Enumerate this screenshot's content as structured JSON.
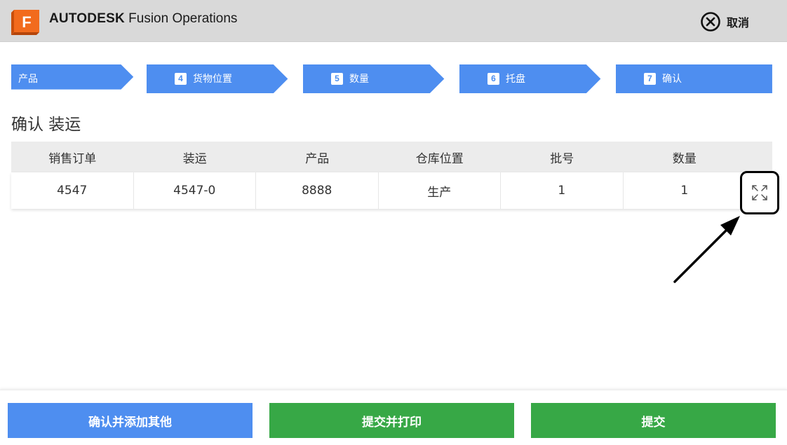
{
  "header": {
    "brand_bold": "AUTODESK",
    "brand_rest": "Fusion Operations",
    "logo_letter": "F",
    "cancel_label": "取消",
    "colors": {
      "logo": "#f26b1d",
      "bar": "#d9d9d9"
    }
  },
  "steps": [
    {
      "num": "",
      "label": "产品"
    },
    {
      "num": "4",
      "label": "货物位置"
    },
    {
      "num": "5",
      "label": "数量"
    },
    {
      "num": "6",
      "label": "托盘"
    },
    {
      "num": "7",
      "label": "确认"
    }
  ],
  "step_color": "#4e8ef0",
  "title": "确认 装运",
  "table": {
    "columns": [
      "销售订单",
      "装运",
      "产品",
      "仓库位置",
      "批号",
      "数量"
    ],
    "rows": [
      [
        "4547",
        "4547-0",
        "8888",
        "生产",
        "1",
        "1"
      ]
    ]
  },
  "expand_icon": "expand-icon",
  "footer": {
    "confirm_add_label": "确认并添加其他",
    "submit_print_label": "提交并打印",
    "submit_label": "提交",
    "colors": {
      "blue": "#4e8ef0",
      "green": "#37a846"
    }
  }
}
